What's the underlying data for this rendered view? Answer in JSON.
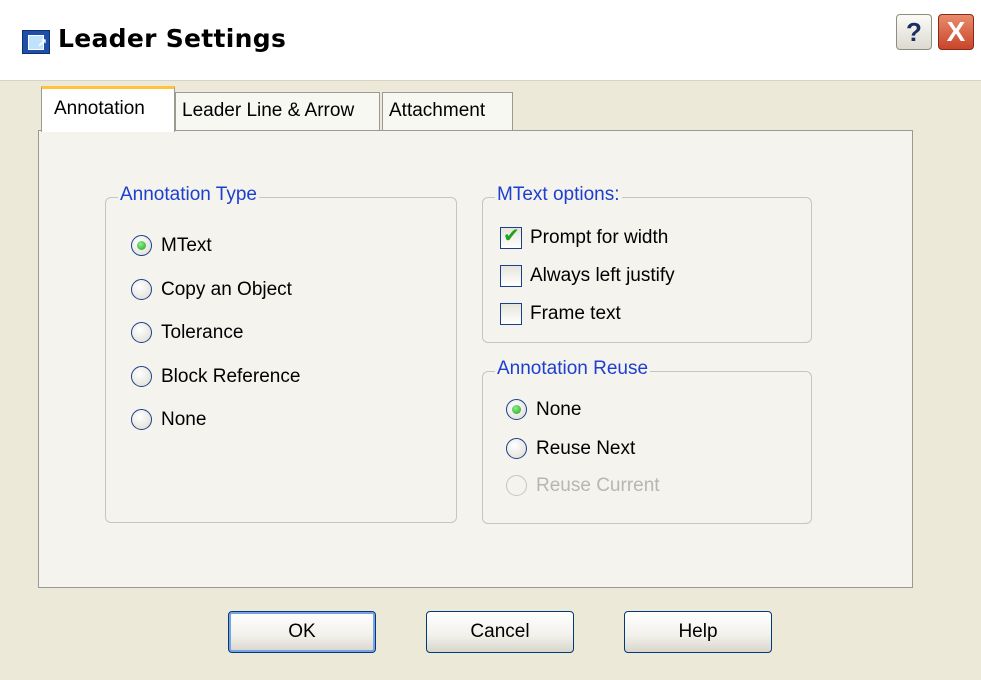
{
  "window": {
    "title": "Leader Settings",
    "help_glyph": "?",
    "close_glyph": "X",
    "icon": "leader-settings-icon"
  },
  "tabs": [
    {
      "label": "Annotation",
      "selected": true
    },
    {
      "label": "Leader Line & Arrow",
      "selected": false
    },
    {
      "label": "Attachment",
      "selected": false
    }
  ],
  "annotation_type": {
    "label": "Annotation Type",
    "options": [
      {
        "label": "MText",
        "selected": true
      },
      {
        "label": "Copy an Object",
        "selected": false
      },
      {
        "label": "Tolerance",
        "selected": false
      },
      {
        "label": "Block Reference",
        "selected": false
      },
      {
        "label": "None",
        "selected": false
      }
    ]
  },
  "mtext_options": {
    "label": "MText options:",
    "options": [
      {
        "label": "Prompt for width",
        "checked": true
      },
      {
        "label": "Always left justify",
        "checked": false
      },
      {
        "label": "Frame text",
        "checked": false
      }
    ]
  },
  "annotation_reuse": {
    "label": "Annotation Reuse",
    "options": [
      {
        "label": "None",
        "selected": true,
        "enabled": true
      },
      {
        "label": "Reuse Next",
        "selected": false,
        "enabled": true
      },
      {
        "label": "Reuse Current",
        "selected": false,
        "enabled": false
      }
    ]
  },
  "buttons": {
    "ok": "OK",
    "cancel": "Cancel",
    "help": "Help"
  },
  "colors": {
    "group_label": "#1d3fcf",
    "selected_tab_accent": "#ffc23c",
    "close_button": "#c9452a",
    "radio_dot": "#21a121"
  }
}
